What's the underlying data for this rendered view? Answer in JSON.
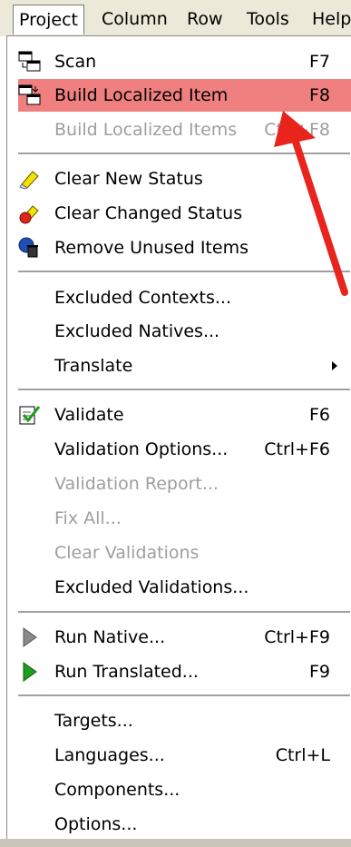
{
  "menubar": {
    "items": [
      "Project",
      "Column",
      "Row",
      "Tools",
      "Help"
    ]
  },
  "menu": {
    "scan": {
      "label": "Scan",
      "shortcut": "F7"
    },
    "build_item": {
      "label": "Build Localized Item",
      "shortcut": "F8"
    },
    "build_items": {
      "label": "Build Localized Items",
      "shortcut": "Ctrl+F8"
    },
    "clear_new": {
      "label": "Clear New Status"
    },
    "clear_changed": {
      "label": "Clear Changed Status"
    },
    "remove_unused": {
      "label": "Remove Unused Items"
    },
    "excluded_contexts": {
      "label": "Excluded Contexts..."
    },
    "excluded_natives": {
      "label": "Excluded Natives..."
    },
    "translate": {
      "label": "Translate"
    },
    "validate": {
      "label": "Validate",
      "shortcut": "F6"
    },
    "validation_options": {
      "label": "Validation Options...",
      "shortcut": "Ctrl+F6"
    },
    "validation_report": {
      "label": "Validation Report..."
    },
    "fix_all": {
      "label": "Fix All..."
    },
    "clear_validations": {
      "label": "Clear Validations"
    },
    "excluded_validations": {
      "label": "Excluded Validations..."
    },
    "run_native": {
      "label": "Run Native...",
      "shortcut": "Ctrl+F9"
    },
    "run_translated": {
      "label": "Run Translated...",
      "shortcut": "F9"
    },
    "targets": {
      "label": "Targets..."
    },
    "languages": {
      "label": "Languages...",
      "shortcut": "Ctrl+L"
    },
    "components": {
      "label": "Components..."
    },
    "options": {
      "label": "Options..."
    }
  },
  "colors": {
    "highlight": "#f08080",
    "annotation_arrow": "#e8241c",
    "disabled_text": "#9e9e9e"
  }
}
